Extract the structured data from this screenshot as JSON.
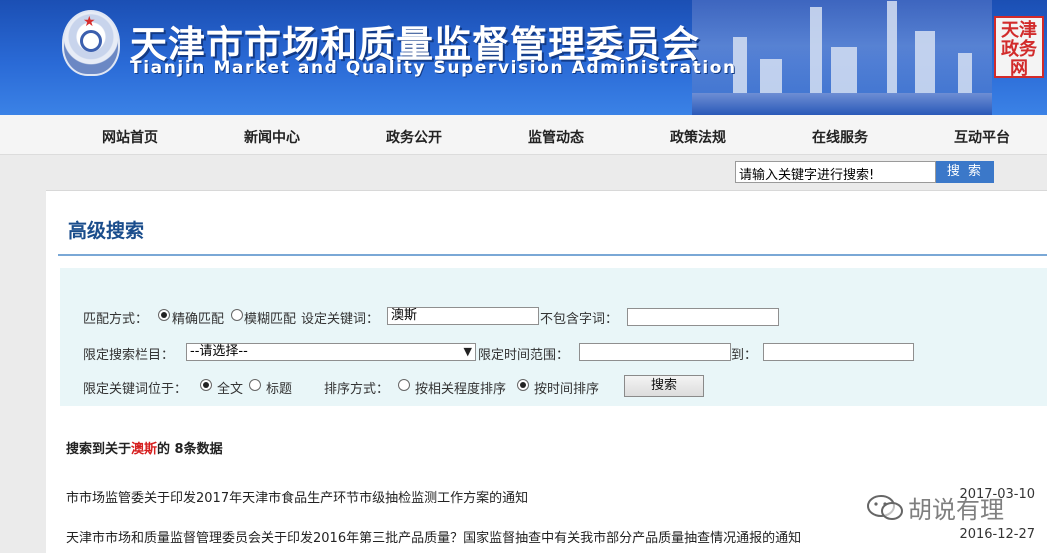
{
  "header": {
    "title_cn": "天津市市场和质量监督管理委员会",
    "title_en": "Tianjin Market and Quality Supervision Administration",
    "seal_text": "天津政务网"
  },
  "nav": [
    "网站首页",
    "新闻中心",
    "政务公开",
    "监管动态",
    "政策法规",
    "在线服务",
    "互动平台"
  ],
  "top_search": {
    "value": "请输入关键字进行搜索!",
    "button": "搜 索"
  },
  "advanced": {
    "title": "高级搜索",
    "match_label": "匹配方式：",
    "exact": "精确匹配",
    "fuzzy": "模糊匹配",
    "keyword_label": "设定关键词：",
    "keyword_value": "澳斯",
    "exclude_label": "不包含字词：",
    "exclude_value": "",
    "column_label": "限定搜索栏目：",
    "column_selected": "--请选择--",
    "time_label": "限定时间范围：",
    "time_from": "",
    "time_to_label": "到：",
    "time_to": "",
    "position_label": "限定关键词位于：",
    "fulltext": "全文",
    "title_opt": "标题",
    "sort_label": "排序方式：",
    "sort_relevance": "按相关程度排序",
    "sort_time": "按时间排序",
    "search_button": "搜索"
  },
  "summary": {
    "prefix": "搜索到关于",
    "keyword": "澳斯",
    "suffix": "的 8条数据"
  },
  "results": [
    {
      "title": "市市场监管委关于印发2017年天津市食品生产环节市级抽检监测工作方案的通知",
      "date": "2017-03-10"
    },
    {
      "title": "天津市市场和质量监督管理委员会关于印发2016年第三批产品质量？国家监督抽查中有关我市部分产品质量抽查情况通报的通知",
      "date": "2016-12-27"
    }
  ],
  "watermark": "胡说有理",
  "colors": {
    "banner": "#2a6ad6",
    "title_blue": "#1a4d8c",
    "keyword_red": "#d61f1f",
    "form_bg": "#e9f6f8"
  }
}
